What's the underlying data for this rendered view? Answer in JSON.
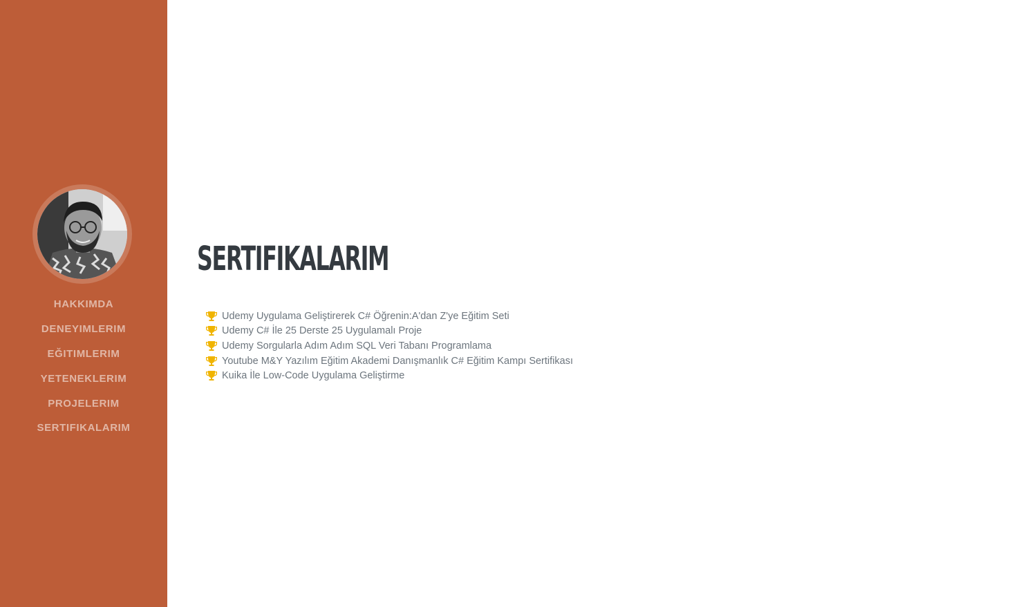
{
  "colors": {
    "sidebar": "#bd5d38",
    "title": "#343a40",
    "text": "#6c757d",
    "trophy": "#f0b400"
  },
  "sidebar": {
    "avatar_icon": "profile-photo",
    "nav_items": [
      {
        "label": "HAKKIMDA"
      },
      {
        "label": "DENEYIMLERIM"
      },
      {
        "label": "EĞITIMLERIM"
      },
      {
        "label": "YETENEKLERIM"
      },
      {
        "label": "PROJELERIM"
      },
      {
        "label": "SERTIFIKALARIM"
      }
    ]
  },
  "main": {
    "title": "SERTIFIKALARIM",
    "certificates": [
      {
        "icon": "trophy-icon",
        "text": "Udemy Uygulama Geliştirerek C# Öğrenin:A'dan Z'ye Eğitim Seti"
      },
      {
        "icon": "trophy-icon",
        "text": "Udemy C# İle 25 Derste 25 Uygulamalı Proje"
      },
      {
        "icon": "trophy-icon",
        "text": "Udemy Sorgularla Adım Adım SQL Veri Tabanı Programlama"
      },
      {
        "icon": "trophy-icon",
        "text": "Youtube M&Y Yazılım Eğitim Akademi Danışmanlık C# Eğitim Kampı Sertifikası"
      },
      {
        "icon": "trophy-icon",
        "text": "Kuika İle Low-Code Uygulama Geliştirme"
      }
    ]
  }
}
